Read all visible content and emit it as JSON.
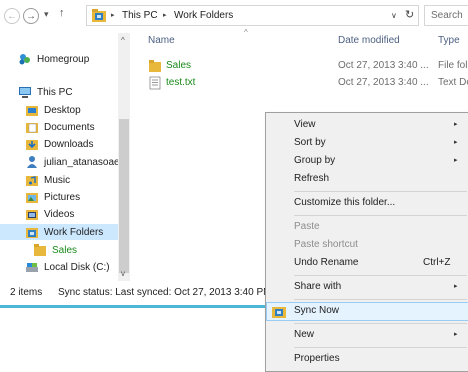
{
  "toolbar": {
    "back_symbol": "←",
    "forward_symbol": "→",
    "recent_symbol": "▾",
    "up_symbol": "↑"
  },
  "address": {
    "crumbs": [
      "This PC",
      "Work Folders"
    ],
    "separator": "▸",
    "dropdown_symbol": "∨",
    "refresh_symbol": "↻"
  },
  "search": {
    "placeholder": "Search"
  },
  "nav": {
    "items": [
      {
        "label": "Homegroup",
        "icon": "homegroup-icon"
      },
      {
        "label": "This PC",
        "icon": "computer-icon"
      },
      {
        "label": "Desktop",
        "icon": "desktop-folder-icon"
      },
      {
        "label": "Documents",
        "icon": "documents-folder-icon"
      },
      {
        "label": "Downloads",
        "icon": "downloads-folder-icon"
      },
      {
        "label": "julian_atanasoae_",
        "icon": "user-icon"
      },
      {
        "label": "Music",
        "icon": "music-folder-icon"
      },
      {
        "label": "Pictures",
        "icon": "pictures-folder-icon"
      },
      {
        "label": "Videos",
        "icon": "videos-folder-icon"
      },
      {
        "label": "Work Folders",
        "icon": "work-folders-icon",
        "selected": true
      },
      {
        "label": "Sales",
        "icon": "folder-icon"
      },
      {
        "label": "Local Disk (C:)",
        "icon": "drive-icon"
      }
    ],
    "scroll_up": "^",
    "scroll_down": "v"
  },
  "list": {
    "columns": [
      "Name",
      "Date modified",
      "Type"
    ],
    "sort_indicator": "^",
    "rows": [
      {
        "name": "Sales",
        "date": "Oct 27, 2013 3:40 ...",
        "type": "File fol",
        "icon": "folder-icon"
      },
      {
        "name": "test.txt",
        "date": "Oct 27, 2013 3:40 ...",
        "type": "Text Do",
        "icon": "text-file-icon"
      }
    ]
  },
  "status": {
    "item_count": "2 items",
    "sync": "Sync status:  Last synced: Oct 27, 2013 3:40 PM"
  },
  "context_menu": {
    "items": [
      {
        "label": "View",
        "submenu": true
      },
      {
        "label": "Sort by",
        "submenu": true
      },
      {
        "label": "Group by",
        "submenu": true
      },
      {
        "label": "Refresh"
      },
      {
        "label": "Customize this folder..."
      },
      {
        "label": "Paste",
        "disabled": true
      },
      {
        "label": "Paste shortcut",
        "disabled": true
      },
      {
        "label": "Undo Rename",
        "shortcut": "Ctrl+Z"
      },
      {
        "label": "Share with",
        "submenu": true
      },
      {
        "label": "Sync Now",
        "highlighted": true,
        "icon": "work-folders-icon"
      },
      {
        "label": "New",
        "submenu": true
      },
      {
        "label": "Properties"
      }
    ],
    "submenu_arrow": "▸"
  },
  "colors": {
    "accent_blue": "#4fb7d6",
    "selection": "#cce8ff",
    "synced_green": "#1a8a1a",
    "folder_yellow": "#e8b83c"
  }
}
